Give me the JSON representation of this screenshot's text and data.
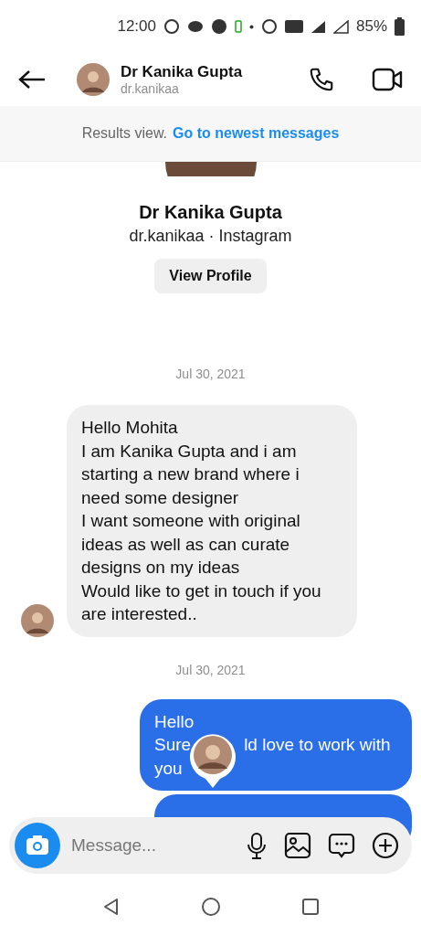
{
  "status_bar": {
    "time": "12:00",
    "battery": "85%"
  },
  "header": {
    "name": "Dr Kanika Gupta",
    "username": "dr.kanikaa"
  },
  "banner": {
    "text": "Results view.",
    "link": "Go to newest messages"
  },
  "profile": {
    "name": "Dr Kanika Gupta",
    "subtitle": "dr.kanikaa · Instagram",
    "button": "View Profile"
  },
  "messages": [
    {
      "kind": "date",
      "text": "Jul 30, 2021"
    },
    {
      "kind": "received",
      "lines": [
        [
          "Hello Mohita"
        ],
        [
          "I am Kanika Gupta and i am starting a new brand where i need some designer"
        ],
        [
          "I want someone with original ideas as well as can curate designs on my ideas"
        ],
        [
          "Would like to get in touch if you are interested.."
        ]
      ]
    },
    {
      "kind": "date",
      "text": "Jul 30, 2021"
    },
    {
      "kind": "sent",
      "seen_avatar": true,
      "lines": [
        [
          "Hello"
        ],
        [
          "Sure",
          "ld love to work with"
        ],
        [
          "you"
        ]
      ]
    },
    {
      "kind": "sent"
    }
  ],
  "composer": {
    "placeholder": "Message..."
  }
}
